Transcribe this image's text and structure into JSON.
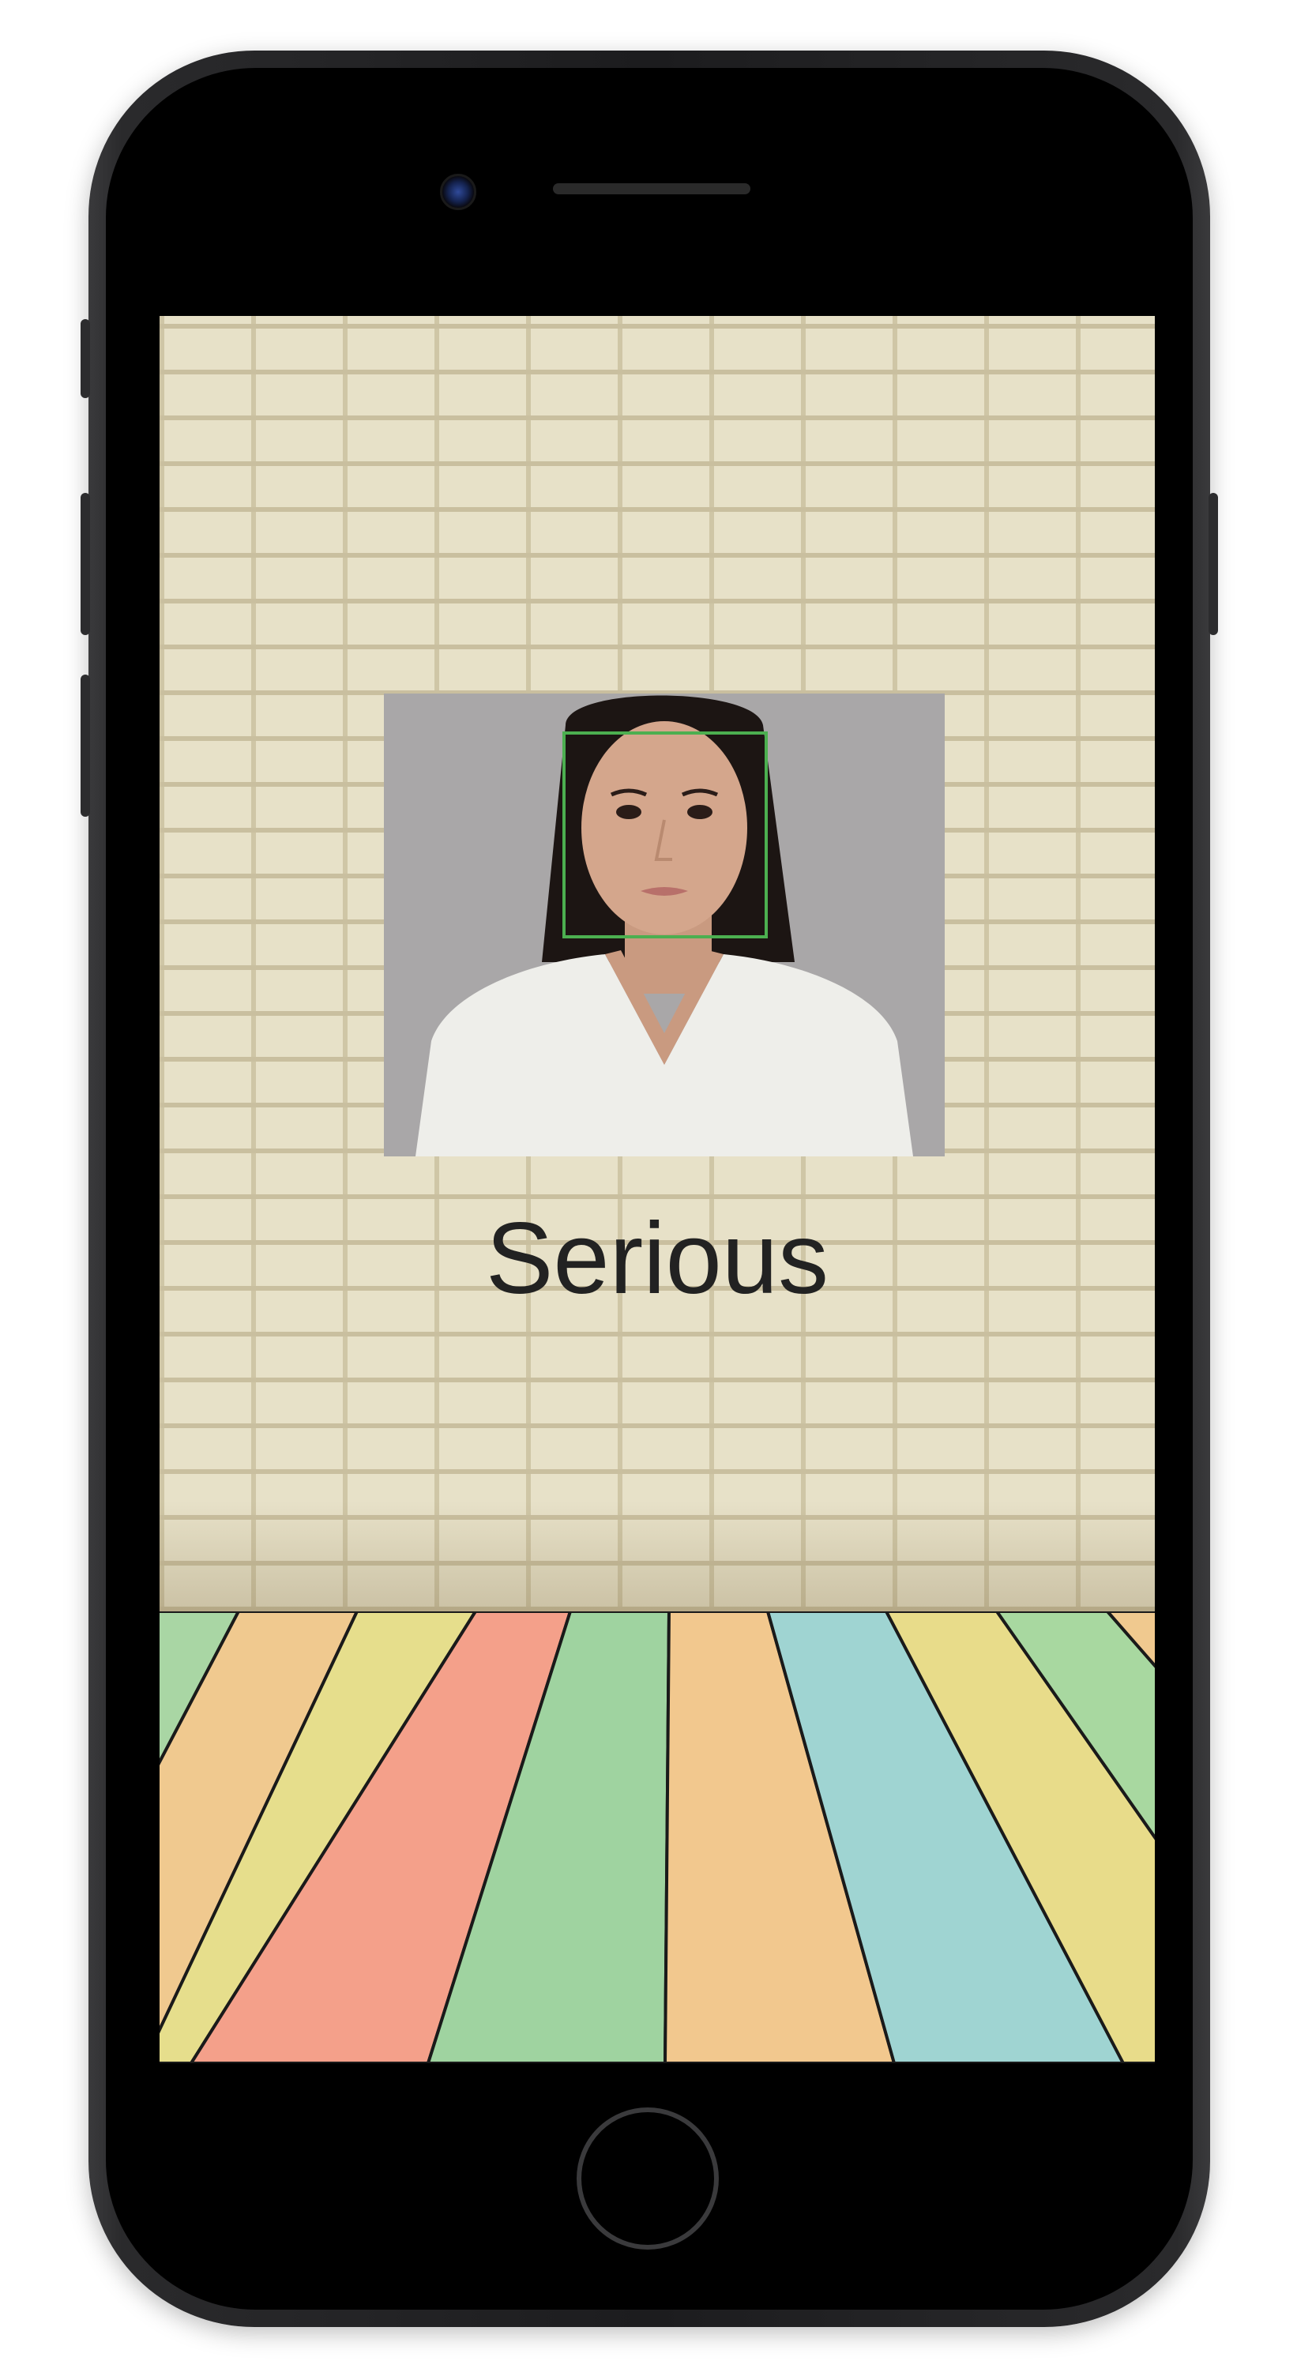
{
  "result": {
    "emotion_label": "Serious"
  },
  "colors": {
    "face_box": "#4caf50",
    "label_text": "#222222",
    "floor_planks": [
      "#a9d6a4",
      "#f0c98f",
      "#e6de8c",
      "#f4a08a",
      "#9fd3a0",
      "#f2c88e",
      "#9fd4d2",
      "#e8dc8a",
      "#a8d8a0"
    ]
  },
  "icons": {
    "front_camera": "camera-dot",
    "earpiece": "speaker-slot",
    "home": "home-circle"
  }
}
